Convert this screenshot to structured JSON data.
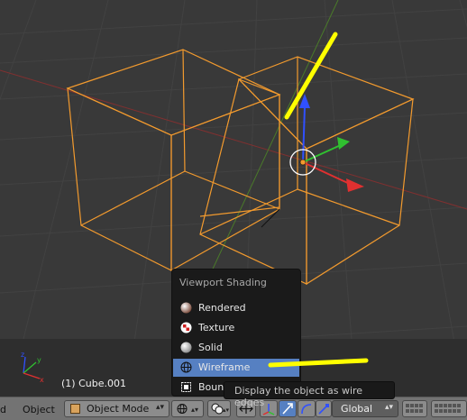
{
  "viewport": {
    "object_info": "(1) Cube.001"
  },
  "header": {
    "menu_view_partial": "d",
    "menu_object": "Object",
    "mode_label": "Object Mode",
    "orientation_label": "Global",
    "active_button": "manipulator-rotate-button"
  },
  "shading_menu": {
    "title": "Viewport Shading",
    "items": [
      {
        "label": "Rendered",
        "icon": "rendered-sphere-icon"
      },
      {
        "label": "Texture",
        "icon": "texture-checker-icon"
      },
      {
        "label": "Solid",
        "icon": "solid-sphere-icon"
      },
      {
        "label": "Wireframe",
        "icon": "wireframe-globe-icon",
        "selected": true
      },
      {
        "label": "Bounding Box",
        "icon": "bounding-box-icon"
      }
    ]
  },
  "tooltip": {
    "text": "Display the object as wire edges"
  },
  "colors": {
    "viewport_bg": "#393939",
    "wire_selected": "#f29a2e",
    "highlight_blue": "#5680c2",
    "annotation_yellow": "#ffff00",
    "axis_x": "#e03030",
    "axis_y": "#30c030",
    "axis_z": "#3050ff"
  }
}
